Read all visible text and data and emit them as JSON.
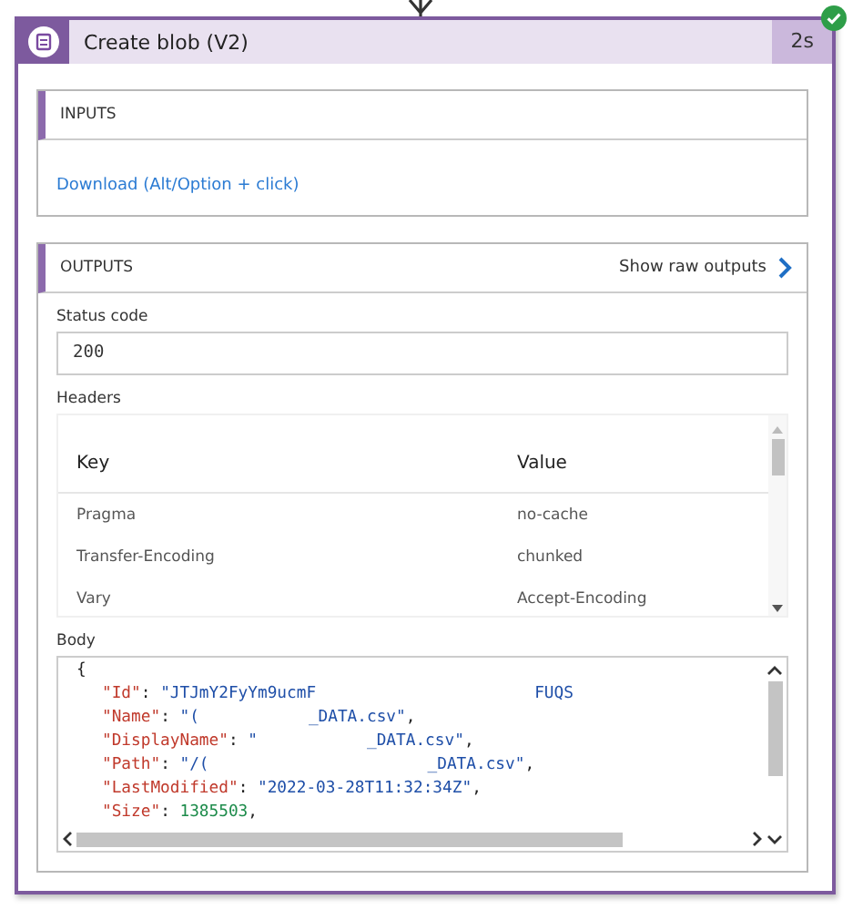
{
  "action": {
    "title": "Create blob (V2)",
    "duration": "2s",
    "succeeded": true
  },
  "inputs": {
    "title": "INPUTS",
    "link": "Download (Alt/Option + click)"
  },
  "outputs": {
    "title": "OUTPUTS",
    "raw_link": "Show raw outputs",
    "status_code": {
      "label": "Status code",
      "value": "200"
    },
    "headers": {
      "label": "Headers",
      "columns": [
        "Key",
        "Value"
      ],
      "rows": [
        [
          "Pragma",
          "no-cache"
        ],
        [
          "Transfer-Encoding",
          "chunked"
        ],
        [
          "Vary",
          "Accept-Encoding"
        ]
      ]
    },
    "body": {
      "label": "Body",
      "open": "{",
      "fields": [
        [
          {
            "kind": "key",
            "text": "\"Id\""
          },
          {
            "kind": "punct",
            "text": ": "
          },
          {
            "kind": "str",
            "text": "\"JTJmY2FyYm9ucmF"
          },
          {
            "kind": "gap"
          },
          {
            "kind": "gap"
          },
          {
            "kind": "str",
            "text": "FUQS"
          }
        ],
        [
          {
            "kind": "key",
            "text": "\"Name\""
          },
          {
            "kind": "punct",
            "text": ": "
          },
          {
            "kind": "str",
            "text": "\"("
          },
          {
            "kind": "gap"
          },
          {
            "kind": "str",
            "text": "_DATA.csv\""
          },
          {
            "kind": "punct",
            "text": ","
          }
        ],
        [
          {
            "kind": "key",
            "text": "\"DisplayName\""
          },
          {
            "kind": "punct",
            "text": ": "
          },
          {
            "kind": "str",
            "text": "\""
          },
          {
            "kind": "gap"
          },
          {
            "kind": "str",
            "text": "_DATA.csv\""
          },
          {
            "kind": "punct",
            "text": ","
          }
        ],
        [
          {
            "kind": "key",
            "text": "\"Path\""
          },
          {
            "kind": "punct",
            "text": ": "
          },
          {
            "kind": "str",
            "text": "\"/("
          },
          {
            "kind": "gap"
          },
          {
            "kind": "gap"
          },
          {
            "kind": "str",
            "text": "_DATA.csv\""
          },
          {
            "kind": "punct",
            "text": ","
          }
        ],
        [
          {
            "kind": "key",
            "text": "\"LastModified\""
          },
          {
            "kind": "punct",
            "text": ": "
          },
          {
            "kind": "str",
            "text": "\"2022-03-28T11:32:34Z\""
          },
          {
            "kind": "punct",
            "text": ","
          }
        ],
        [
          {
            "kind": "key",
            "text": "\"Size\""
          },
          {
            "kind": "punct",
            "text": ": "
          },
          {
            "kind": "num",
            "text": "1385503"
          },
          {
            "kind": "punct",
            "text": ","
          }
        ]
      ]
    }
  }
}
